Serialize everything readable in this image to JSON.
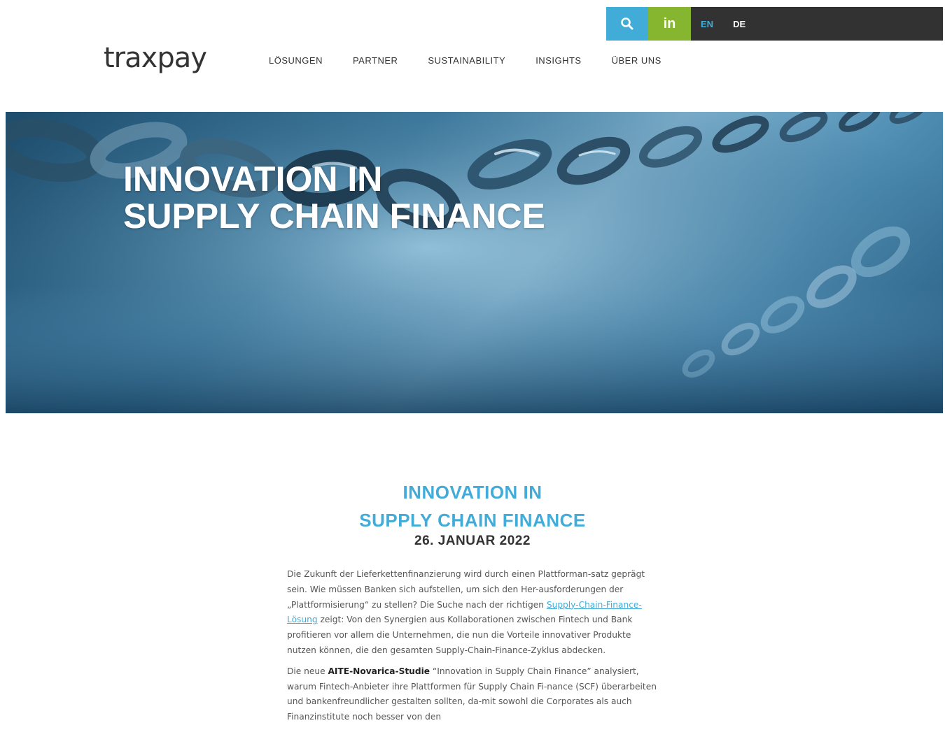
{
  "brand": {
    "logo_text": "traxpay"
  },
  "utility": {
    "search_icon": "search-icon",
    "linkedin_label": "in",
    "languages": [
      {
        "label": "EN",
        "active": true
      },
      {
        "label": "DE",
        "active": false
      }
    ]
  },
  "nav": {
    "items": [
      {
        "label": "LÖSUNGEN"
      },
      {
        "label": "PARTNER"
      },
      {
        "label": "SUSTAINABILITY"
      },
      {
        "label": "INSIGHTS"
      },
      {
        "label": "ÜBER UNS"
      }
    ]
  },
  "hero": {
    "title_line1": "INNOVATION IN",
    "title_line2": "SUPPLY CHAIN FINANCE"
  },
  "article": {
    "title_line1": "INNOVATION IN",
    "title_line2": "SUPPLY CHAIN FINANCE",
    "date": "26. JANUAR 2022",
    "p1_before_link": "Die Zukunft der Lieferkettenfinanzierung wird durch einen Plattforman-satz geprägt sein. Wie müssen Banken sich aufstellen, um sich den Her-ausforderungen der „Plattformisierung“ zu stellen? Die Suche nach der richtigen ",
    "p1_link": "Supply-Chain-Finance-Lösung",
    "p1_after_link": " zeigt: Von den Synergien aus Kollaborationen zwischen Fintech und Bank profitieren vor allem die Unternehmen, die nun die Vorteile innovativer Produkte nutzen können, die den gesamten Supply-Chain-Finance-Zyklus abdecken.",
    "p2_before_bold": "Die neue ",
    "p2_bold": "AITE-Novarica-Studie",
    "p2_after_bold": " “Innovation in Supply Chain Finance” analysiert, warum Fintech-Anbieter ihre Plattformen für Supply Chain Fi-nance (SCF) überarbeiten und bankenfreundlicher gestalten sollten, da-mit sowohl die Corporates als auch Finanzinstitute noch besser von den"
  },
  "colors": {
    "accent_blue": "#42acd9",
    "linkedin_green": "#86b52f",
    "bar_dark": "#323232"
  }
}
